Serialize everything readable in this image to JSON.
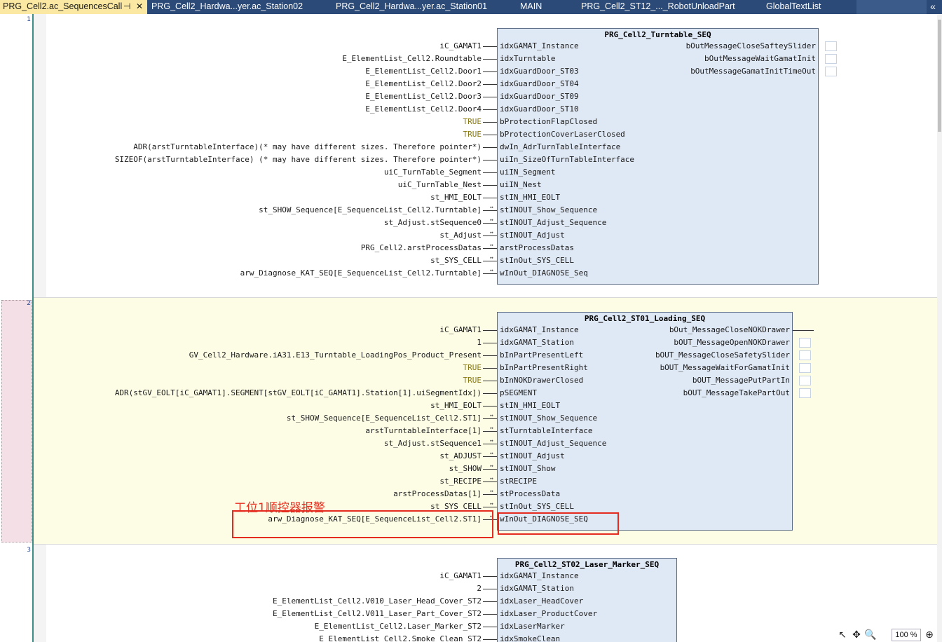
{
  "tabs": [
    {
      "label": "PRG_Cell2.ac_SequencesCall",
      "pin": "⊣",
      "close": "✕"
    },
    {
      "label": "PRG_Cell2_Hardwa...yer.ac_Station02"
    },
    {
      "label": "PRG_Cell2_Hardwa...yer.ac_Station01"
    },
    {
      "label": "MAIN"
    },
    {
      "label": "PRG_Cell2_ST12_..._RobotUnloadPart"
    },
    {
      "label": "GlobalTextList"
    }
  ],
  "tab_overflow": "«",
  "networks": [
    {
      "number": "1",
      "block": {
        "title": "PRG_Cell2_Turntable_SEQ",
        "inputs": [
          {
            "pin": "idxGAMAT_Instance",
            "arg": "iC_GAMAT1",
            "keyword": false,
            "inout": false
          },
          {
            "pin": "idxTurntable",
            "arg": "E_ElementList_Cell2.Roundtable",
            "keyword": false,
            "inout": false
          },
          {
            "pin": "idxGuardDoor_ST03",
            "arg": "E_ElementList_Cell2.Door1",
            "keyword": false,
            "inout": false
          },
          {
            "pin": "idxGuardDoor_ST04",
            "arg": "E_ElementList_Cell2.Door2",
            "keyword": false,
            "inout": false
          },
          {
            "pin": "idxGuardDoor_ST09",
            "arg": "E_ElementList_Cell2.Door3",
            "keyword": false,
            "inout": false
          },
          {
            "pin": "idxGuardDoor_ST10",
            "arg": "E_ElementList_Cell2.Door4",
            "keyword": false,
            "inout": false
          },
          {
            "pin": "bProtectionFlapClosed",
            "arg": "TRUE",
            "keyword": true,
            "inout": false
          },
          {
            "pin": "bProtectionCoverLaserClosed",
            "arg": "TRUE",
            "keyword": true,
            "inout": false
          },
          {
            "pin": "dwIn_AdrTurnTableInterface",
            "arg": "ADR(arstTurntableInterface)(* may have different sizes. Therefore pointer*)",
            "keyword": false,
            "inout": false
          },
          {
            "pin": "uiIn_SizeOfTurnTableInterface",
            "arg": "SIZEOF(arstTurntableInterface) (* may have different sizes. Therefore pointer*)",
            "keyword": false,
            "inout": false
          },
          {
            "pin": "uiIN_Segment",
            "arg": "uiC_TurnTable_Segment",
            "keyword": false,
            "inout": false
          },
          {
            "pin": "uiIN_Nest",
            "arg": "uiC_TurnTable_Nest",
            "keyword": false,
            "inout": false
          },
          {
            "pin": "stIN_HMI_EOLT",
            "arg": "st_HMI_EOLT",
            "keyword": false,
            "inout": false
          },
          {
            "pin": "stINOUT_Show_Sequence",
            "arg": "st_SHOW_Sequence[E_SequenceList_Cell2.Turntable]",
            "keyword": false,
            "inout": true
          },
          {
            "pin": "stINOUT_Adjust_Sequence",
            "arg": "st_Adjust.stSequence0",
            "keyword": false,
            "inout": true
          },
          {
            "pin": "stINOUT_Adjust",
            "arg": "st_Adjust",
            "keyword": false,
            "inout": true
          },
          {
            "pin": "arstProcessDatas",
            "arg": "PRG_Cell2.arstProcessDatas",
            "keyword": false,
            "inout": true
          },
          {
            "pin": "stInOut_SYS_CELL",
            "arg": "st_SYS_CELL",
            "keyword": false,
            "inout": true
          },
          {
            "pin": "wInOut_DIAGNOSE_Seq",
            "arg": "arw_Diagnose_KAT_SEQ[E_SequenceList_Cell2.Turntable]",
            "keyword": false,
            "inout": true
          }
        ],
        "outputs": [
          {
            "pin": "bOutMessageCloseSafteySlider",
            "wired": false
          },
          {
            "pin": "bOutMessageWaitGamatInit",
            "wired": false
          },
          {
            "pin": "bOutMessageGamatInitTimeOut",
            "wired": false
          }
        ]
      }
    },
    {
      "number": "2",
      "block": {
        "title": "PRG_Cell2_ST01_Loading_SEQ",
        "inputs": [
          {
            "pin": "idxGAMAT_Instance",
            "arg": "iC_GAMAT1",
            "keyword": false,
            "inout": false
          },
          {
            "pin": "idxGAMAT_Station",
            "arg": "1",
            "keyword": false,
            "inout": false
          },
          {
            "pin": "bInPartPresentLeft",
            "arg": "GV_Cell2_Hardware.iA31.E13_Turntable_LoadingPos_Product_Present",
            "keyword": false,
            "inout": false
          },
          {
            "pin": "bInPartPresentRight",
            "arg": "TRUE",
            "keyword": true,
            "inout": false
          },
          {
            "pin": "bInNOKDrawerClosed",
            "arg": "TRUE",
            "keyword": true,
            "inout": false
          },
          {
            "pin": "pSEGMENT",
            "arg": "ADR(stGV_EOLT[iC_GAMAT1].SEGMENT[stGV_EOLT[iC_GAMAT1].Station[1].uiSegmentIdx])",
            "keyword": false,
            "inout": false
          },
          {
            "pin": "stIN_HMI_EOLT",
            "arg": "st_HMI_EOLT",
            "keyword": false,
            "inout": false
          },
          {
            "pin": "stINOUT_Show_Sequence",
            "arg": "st_SHOW_Sequence[E_SequenceList_Cell2.ST1]",
            "keyword": false,
            "inout": true
          },
          {
            "pin": "stTurntableInterface",
            "arg": "arstTurntableInterface[1]",
            "keyword": false,
            "inout": true
          },
          {
            "pin": "stINOUT_Adjust_Sequence",
            "arg": "st_Adjust.stSequence1",
            "keyword": false,
            "inout": true
          },
          {
            "pin": "stINOUT_Adjust",
            "arg": "st_ADJUST",
            "keyword": false,
            "inout": true
          },
          {
            "pin": "stINOUT_Show",
            "arg": "st_SHOW",
            "keyword": false,
            "inout": true
          },
          {
            "pin": "stRECIPE",
            "arg": "st_RECIPE",
            "keyword": false,
            "inout": true
          },
          {
            "pin": "stProcessData",
            "arg": "arstProcessDatas[1]",
            "keyword": false,
            "inout": true
          },
          {
            "pin": "stInOut_SYS_CELL",
            "arg": "st_SYS_CELL",
            "keyword": false,
            "inout": true
          },
          {
            "pin": "wInOut_DIAGNOSE_SEQ",
            "arg": "arw_Diagnose_KAT_SEQ[E_SequenceList_Cell2.ST1]",
            "keyword": false,
            "inout": true
          }
        ],
        "outputs": [
          {
            "pin": "bOut_MessageCloseNOKDrawer",
            "wired": true
          },
          {
            "pin": "bOUT_MessageOpenNOKDrawer",
            "wired": false
          },
          {
            "pin": "bOUT_MessageCloseSafetySlider",
            "wired": false
          },
          {
            "pin": "bOUT_MessageWaitForGamatInit",
            "wired": false
          },
          {
            "pin": "bOUT_MessagePutPartIn",
            "wired": false
          },
          {
            "pin": "bOUT_MessageTakePartOut",
            "wired": false
          }
        ]
      },
      "annotation": "工位1顺控器报警"
    },
    {
      "number": "3",
      "block": {
        "title": "PRG_Cell2_ST02_Laser_Marker_SEQ",
        "inputs": [
          {
            "pin": "idxGAMAT_Instance",
            "arg": "iC_GAMAT1",
            "keyword": false,
            "inout": false
          },
          {
            "pin": "idxGAMAT_Station",
            "arg": "2",
            "keyword": false,
            "inout": false
          },
          {
            "pin": "idxLaser_HeadCover",
            "arg": "E_ElementList_Cell2.V010_Laser_Head_Cover_ST2",
            "keyword": false,
            "inout": false
          },
          {
            "pin": "idxLaser_ProductCover",
            "arg": "E_ElementList_Cell2.V011_Laser_Part_Cover_ST2",
            "keyword": false,
            "inout": false
          },
          {
            "pin": "idxLaserMarker",
            "arg": "E_ElementList_Cell2.Laser_Marker_ST2",
            "keyword": false,
            "inout": false
          },
          {
            "pin": "idxSmokeClean",
            "arg": "E_ElementList_Cell2.Smoke_Clean_ST2",
            "keyword": false,
            "inout": false
          }
        ],
        "outputs": []
      }
    }
  ],
  "tools": {
    "pointer": "↖",
    "move": "✥",
    "zoom": "🔍"
  },
  "zoom_level": "100 %",
  "zoom_icon": "⊕"
}
